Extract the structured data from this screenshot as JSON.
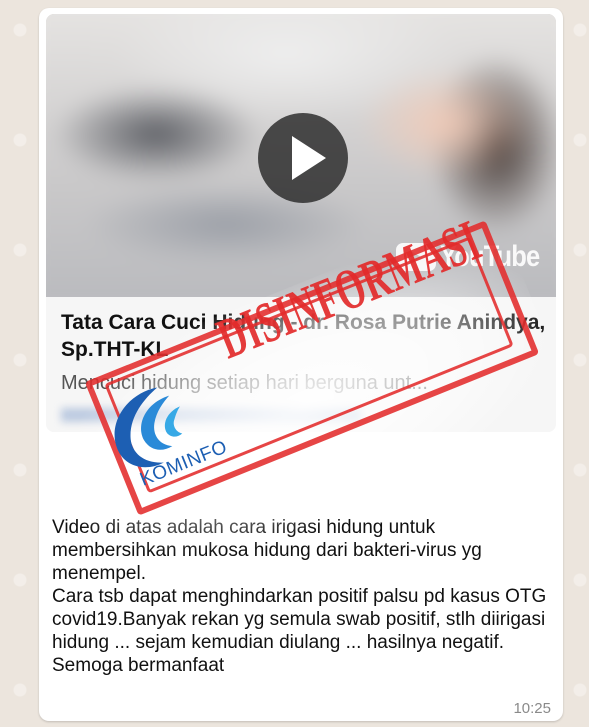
{
  "link_preview": {
    "thumbnail": {
      "play_icon": "play-icon",
      "youtube_logo_text": "YouTube"
    },
    "title": "Tata Cara Cuci Hidung - dr. Rosa Putrie Anindya, Sp.THT-KL",
    "description": "Mencuci hidung setiap hari berguna unt..."
  },
  "message": {
    "text": "Video di atas adalah cara irigasi hidung untuk membersihkan mukosa hidung dari bakteri-virus yg menempel.\nCara tsb dapat menghindarkan positif palsu pd kasus OTG covid19.Banyak rekan yg semula swab positif, stlh diirigasi hidung ... sejam kemudian diulang ... hasilnya negatif. Semoga bermanfaat",
    "timestamp": "10:25"
  },
  "stamp": {
    "label": "DISINFORMASI",
    "logo_text": "KOMINFO",
    "color": "#e32b2b"
  },
  "colors": {
    "chat_background": "#ece5dd",
    "bubble_background": "#ffffff",
    "preview_background": "#f6f6f6"
  }
}
